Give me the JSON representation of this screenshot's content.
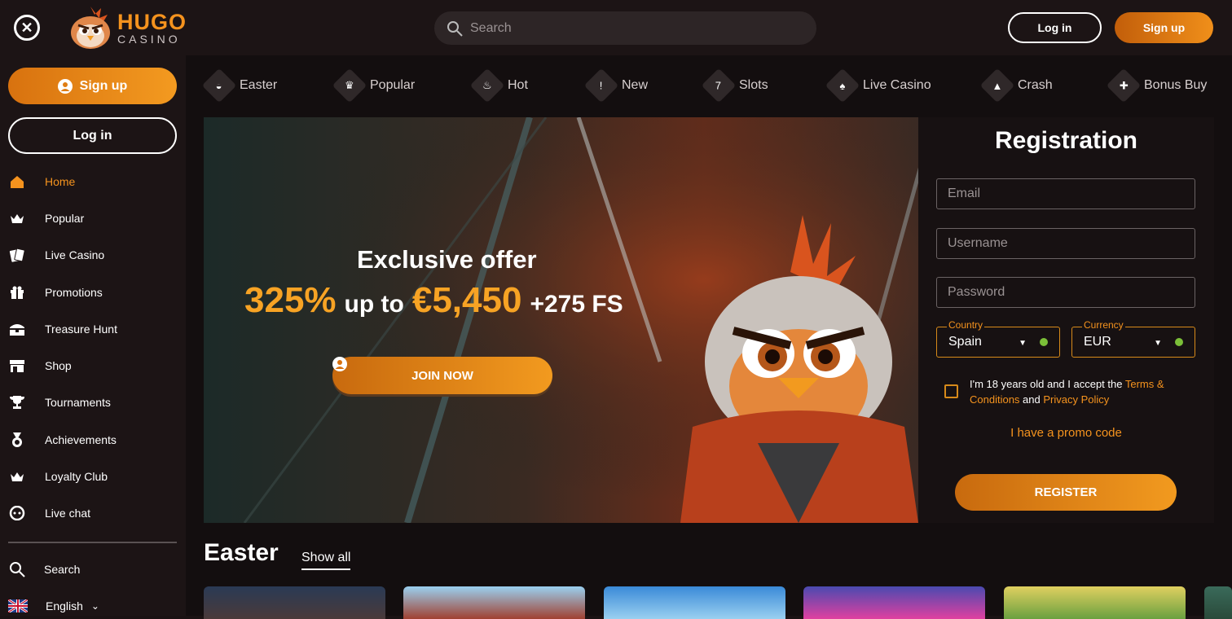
{
  "header": {
    "logo_top": "HUGO",
    "logo_bottom": "CASINO",
    "search_placeholder": "Search",
    "login_label": "Log in",
    "signup_label": "Sign up"
  },
  "sidebar": {
    "signup_label": "Sign up",
    "login_label": "Log in",
    "items": [
      {
        "label": "Home",
        "icon": "home-icon"
      },
      {
        "label": "Popular",
        "icon": "crown-icon"
      },
      {
        "label": "Live Casino",
        "icon": "cards-icon"
      },
      {
        "label": "Promotions",
        "icon": "gift-icon"
      },
      {
        "label": "Treasure Hunt",
        "icon": "chest-icon"
      },
      {
        "label": "Shop",
        "icon": "shop-icon"
      },
      {
        "label": "Tournaments",
        "icon": "trophy-icon"
      },
      {
        "label": "Achievements",
        "icon": "medal-icon"
      },
      {
        "label": "Loyalty Club",
        "icon": "crown-icon"
      },
      {
        "label": "Live chat",
        "icon": "chat-icon"
      }
    ],
    "search_label": "Search",
    "language_label": "English"
  },
  "categories": [
    {
      "label": "Easter",
      "icon": "egg-icon"
    },
    {
      "label": "Popular",
      "icon": "crown-icon"
    },
    {
      "label": "Hot",
      "icon": "flame-icon"
    },
    {
      "label": "New",
      "icon": "exclamation-icon"
    },
    {
      "label": "Slots",
      "icon": "slot-icon"
    },
    {
      "label": "Live Casino",
      "icon": "cards-icon"
    },
    {
      "label": "Crash",
      "icon": "rocket-icon"
    },
    {
      "label": "Bonus Buy",
      "icon": "cart-icon"
    }
  ],
  "banner": {
    "title": "Exclusive offer",
    "percent": "325%",
    "up_to": "up to",
    "amount": "€5,450",
    "fs": "+275 FS",
    "join_label": "JOIN NOW"
  },
  "registration": {
    "title": "Registration",
    "email_placeholder": "Email",
    "username_placeholder": "Username",
    "password_placeholder": "Password",
    "country_label": "Country",
    "country_value": "Spain",
    "currency_label": "Currency",
    "currency_value": "EUR",
    "terms_prefix": "I'm 18 years old and I accept the ",
    "terms_link": "Terms & Conditions",
    "terms_and": " and ",
    "privacy_link": "Privacy Policy",
    "promo_label": "I have a promo code",
    "register_label": "REGISTER"
  },
  "section": {
    "title": "Easter",
    "show_all": "Show all"
  },
  "colors": {
    "accent": "#f5931e",
    "background": "#130e0f",
    "sidebar": "#1c1415"
  }
}
